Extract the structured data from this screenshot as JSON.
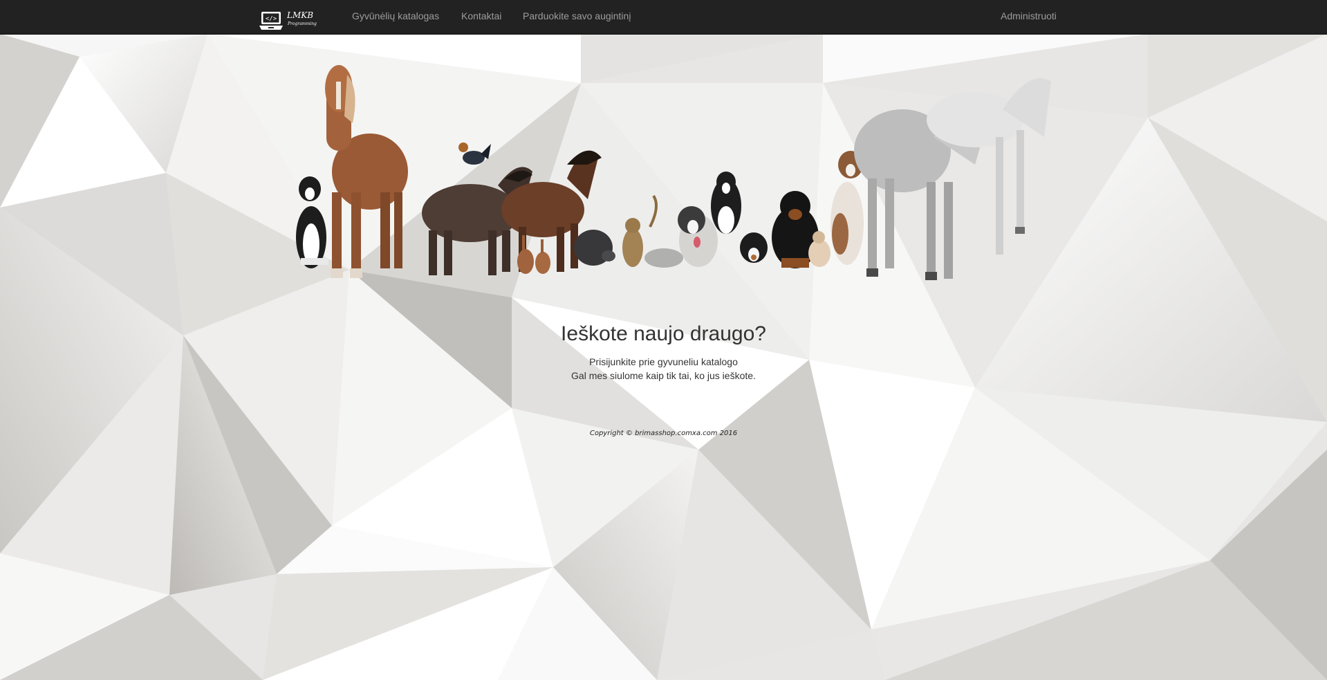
{
  "navbar": {
    "logo_text": "LMKB",
    "logo_subtext": "Programming",
    "links": [
      "Gyvūnėlių katalogas",
      "Kontaktai",
      "Parduokite savo augintinį"
    ],
    "right_link": "Administruoti",
    "background": "#222222",
    "link_color": "#9d9d9d"
  },
  "hero": {
    "image_name": "animals-group-image",
    "heading": "Ieškote naujo draugo?",
    "line1": "Prisijunkite prie gyvuneliu katalogo",
    "line2": "Gal mes siulome kaip tik tai, ko jus ieškote."
  },
  "footer": {
    "copyright": "Copyright © brimasshop.comxa.com 2016"
  }
}
